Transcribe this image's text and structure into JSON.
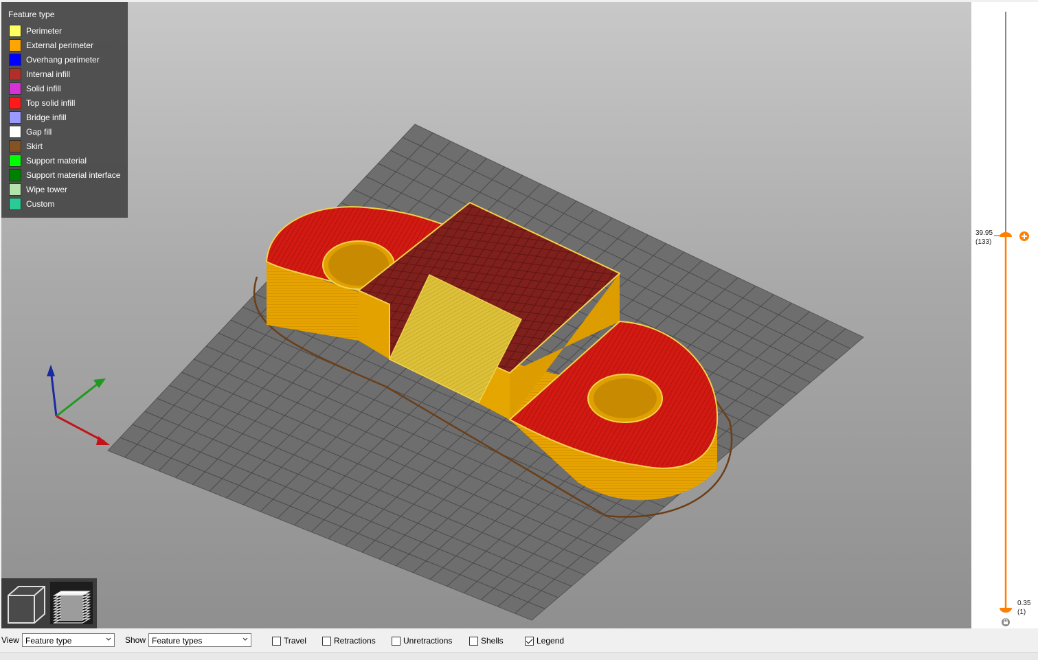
{
  "legend": {
    "title": "Feature type",
    "items": [
      {
        "label": "Perimeter",
        "color": "#ffff60"
      },
      {
        "label": "External perimeter",
        "color": "#ffa500"
      },
      {
        "label": "Overhang perimeter",
        "color": "#0000ff"
      },
      {
        "label": "Internal infill",
        "color": "#b03029"
      },
      {
        "label": "Solid infill",
        "color": "#d732d7"
      },
      {
        "label": "Top solid infill",
        "color": "#ff1a1a"
      },
      {
        "label": "Bridge infill",
        "color": "#9999ff"
      },
      {
        "label": "Gap fill",
        "color": "#ffffff"
      },
      {
        "label": "Skirt",
        "color": "#845321"
      },
      {
        "label": "Support material",
        "color": "#00ff00"
      },
      {
        "label": "Support material interface",
        "color": "#008000"
      },
      {
        "label": "Wipe tower",
        "color": "#b3e3ab"
      },
      {
        "label": "Custom",
        "color": "#28cc94"
      }
    ]
  },
  "slider": {
    "top_value": "39.95",
    "top_layer": "(133)",
    "bottom_value": "0.35",
    "bottom_layer": "(1)",
    "accent": "#ff7f00"
  },
  "toolbar": {
    "view_label": "View",
    "view_value": "Feature type",
    "show_label": "Show",
    "show_value": "Feature types",
    "checks": [
      {
        "label": "Travel",
        "checked": false
      },
      {
        "label": "Retractions",
        "checked": false
      },
      {
        "label": "Unretractions",
        "checked": false
      },
      {
        "label": "Shells",
        "checked": false
      },
      {
        "label": "Legend",
        "checked": true
      }
    ]
  },
  "icons": {
    "view_3d": "cube-icon",
    "view_layers": "layers-icon",
    "add_color_change": "plus-circle-icon",
    "lock": "lock-icon"
  }
}
